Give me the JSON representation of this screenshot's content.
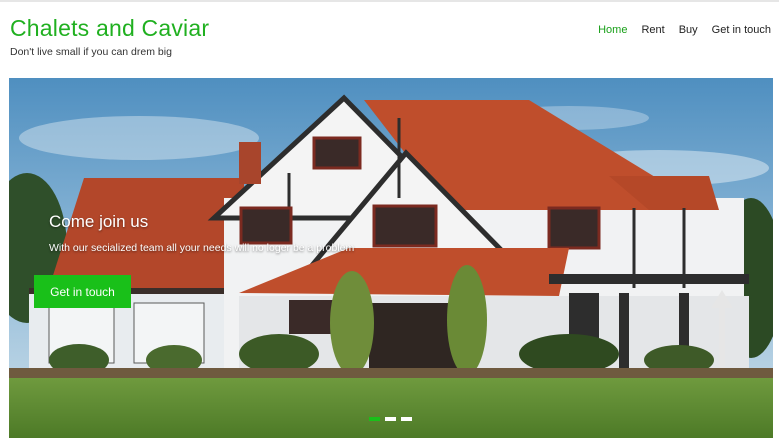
{
  "site": {
    "title": "Chalets and Caviar",
    "tagline": "Don't live small if you can drem big"
  },
  "nav": {
    "items": [
      {
        "label": "Home",
        "active": true
      },
      {
        "label": "Rent",
        "active": false
      },
      {
        "label": "Buy",
        "active": false
      },
      {
        "label": "Get in touch",
        "active": false
      }
    ]
  },
  "hero": {
    "heading": "Come join us",
    "subtext": "With our secialized team all your needs will no loger be a problem",
    "cta_label": "Get in touch",
    "slide_count": 3,
    "active_slide": 1
  },
  "colors": {
    "brand": "#20b020",
    "cta": "#19c019"
  }
}
